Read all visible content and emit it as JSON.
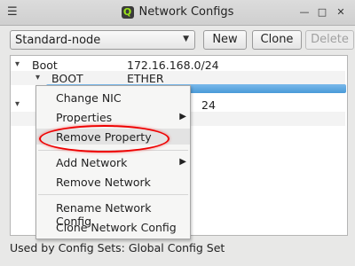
{
  "window": {
    "title": "Network Configs",
    "app_icon_letter": "Q"
  },
  "toolbar": {
    "combo_value": "Standard-node",
    "new_label": "New",
    "clone_label": "Clone",
    "delete_label": "Delete"
  },
  "tree": {
    "rows": [
      {
        "name": "Boot",
        "value": "172.16.168.0/24"
      },
      {
        "name": "BOOT",
        "value": "ETHER"
      },
      {
        "name": "",
        "value": ""
      },
      {
        "name": "",
        "value": "24"
      }
    ]
  },
  "context_menu": {
    "items": [
      {
        "label": "Change NIC"
      },
      {
        "label": "Properties"
      },
      {
        "label": "Remove Property"
      },
      {
        "label": "Add Network"
      },
      {
        "label": "Remove Network"
      },
      {
        "label": "Rename Network Config"
      },
      {
        "label": "Clone Network Config"
      }
    ]
  },
  "status": {
    "text": "Used by Config Sets: Global Config Set"
  },
  "colors": {
    "selection": "#4a9ad8",
    "annotation": "#e00000"
  }
}
